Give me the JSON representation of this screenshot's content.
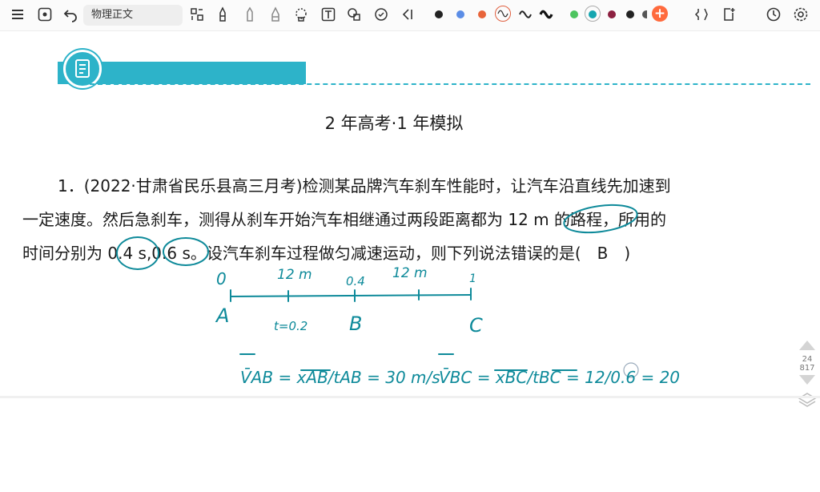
{
  "toolbar": {
    "doc_title": "物理正文",
    "icons": [
      "menu-icon",
      "eye-icon",
      "undo-icon",
      "layout-icon",
      "pen-icon",
      "pencil-icon",
      "marker-icon",
      "lasso-icon",
      "text-icon",
      "shape-icon",
      "eraser-icon",
      "collapse-icon",
      "crop-icon",
      "add-page-icon",
      "history-icon",
      "settings-icon"
    ],
    "colors": {
      "black": "#222222",
      "blue": "#5b8de6",
      "orange": "#e8643a",
      "green": "#4cc45e",
      "teal": "#15a6b0",
      "maroon": "#8c2040",
      "accent": "#ff6a3d"
    }
  },
  "section_title": "2 年高考·1 年模拟",
  "question": {
    "line1": "1．(2022·甘肃省民乐县高三月考)检测某品牌汽车刹车性能时，让汽车沿直线先加速到",
    "line2": "一定速度。然后急刹车，测得从刹车开始汽车相继通过两段距离都为 12 m 的路程，所用的",
    "line3": "时间分别为 0.4 s,0.6 s。设汽车刹车过程做匀减速运动，则下列说法错误的是(　B　)"
  },
  "annotations": {
    "o": "0",
    "d1": "12 m",
    "t04": "0.4",
    "d2": "12 m",
    "one": "1",
    "a": "A",
    "b": "B",
    "c": "C",
    "t": "t=0.2",
    "eq1": "V̄AB = xAB/tAB = 30 m/s",
    "eq2": "V̄BC = xBC/tBC = 12/0.6 = 20"
  },
  "pager": {
    "current": "24",
    "total": "817"
  }
}
